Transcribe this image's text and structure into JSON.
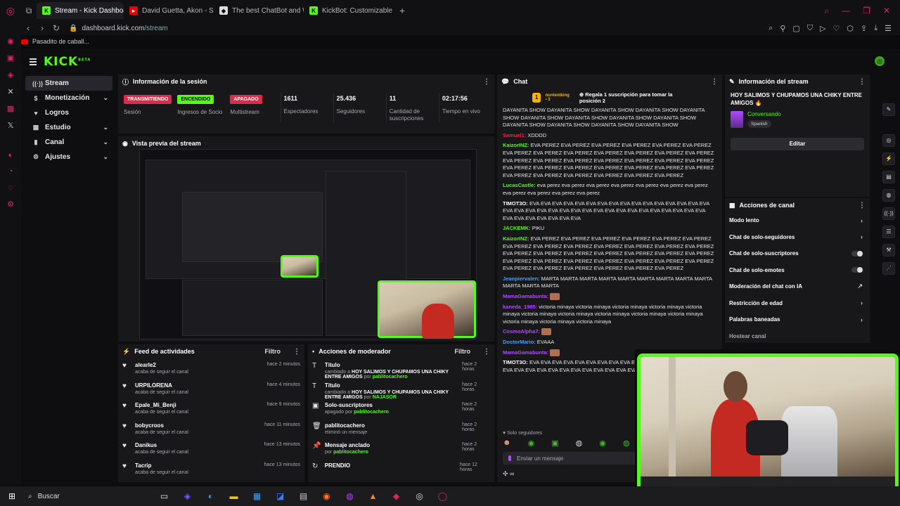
{
  "browser": {
    "tabs": [
      {
        "title": "Stream - Kick Dashboard",
        "active": true
      },
      {
        "title": "David Guetta, Akon - Sex",
        "active": false
      },
      {
        "title": "The best ChatBot and W",
        "active": false
      },
      {
        "title": "KickBot: Customizable Ch",
        "active": false
      }
    ],
    "url_host": "dashboard.kick.com",
    "url_path": "/stream",
    "bookmark": "Pasadito de caball..."
  },
  "app": {
    "logo": "KICK",
    "logo_sup": "BETA",
    "nav": [
      {
        "label": "Stream",
        "icon": "((·))",
        "active": true,
        "chevron": false
      },
      {
        "label": "Monetización",
        "icon": "$",
        "active": false,
        "chevron": true
      },
      {
        "label": "Logros",
        "icon": "♥",
        "active": false,
        "chevron": false
      },
      {
        "label": "Estudio",
        "icon": "▦",
        "active": false,
        "chevron": true
      },
      {
        "label": "Canal",
        "icon": "▮",
        "active": false,
        "chevron": true
      },
      {
        "label": "Ajustes",
        "icon": "⚙",
        "active": false,
        "chevron": true
      }
    ]
  },
  "session": {
    "title": "Información de la sesión",
    "status": [
      {
        "pill": "TRANSMITIENDO",
        "label": "Sesión",
        "color": "red"
      },
      {
        "pill": "ENCENDIDO",
        "label": "Ingresos de Socio",
        "color": "green"
      },
      {
        "pill": "APAGADO",
        "label": "Multistream",
        "color": "red"
      }
    ],
    "stats": [
      {
        "value": "1611",
        "label": "Espectadores"
      },
      {
        "value": "25.436",
        "label": "Seguidores"
      },
      {
        "value": "11",
        "label": "Cantidad de suscripciones"
      },
      {
        "value": "02:17:56",
        "label": "Tiempo en vivo"
      }
    ]
  },
  "preview": {
    "title": "Vista previa del stream"
  },
  "activity": {
    "title": "Feed de actividades",
    "filter": "Filtro",
    "items": [
      {
        "name": "alearle2",
        "sub": "acaba de seguir el canal",
        "time": "hace 2 minutos"
      },
      {
        "name": "URPILORENA",
        "sub": "acaba de seguir el canal",
        "time": "hace 4 minutos"
      },
      {
        "name": "Epale_Mi_Benji",
        "sub": "acaba de seguir el canal",
        "time": "hace 9 minutos"
      },
      {
        "name": "bobycroos",
        "sub": "acaba de seguir el canal",
        "time": "hace 11 minutos"
      },
      {
        "name": "Danikus",
        "sub": "acaba de seguir el canal",
        "time": "hace 13 minutos"
      },
      {
        "name": "Tacrip",
        "sub": "acaba de seguir el canal",
        "time": "hace 13 minutos"
      }
    ]
  },
  "moderator": {
    "title": "Acciones de moderador",
    "filter": "Filtro",
    "items": [
      {
        "icon": "T",
        "name": "Título",
        "pre": "cambiado a",
        "bold": "HOY SALIMOS Y CHUPAMOS UNA CHIKY ENTRE AMIGOS",
        "mid": "por",
        "user": "pablitocachero",
        "time": "hace 2 horas"
      },
      {
        "icon": "T",
        "name": "Título",
        "pre": "cambiado a",
        "bold": "HOY SALIMOS Y CHUPAMOS UNA CHIKY ENTRE AMIGOS",
        "mid": "por",
        "user": "NAJASOR",
        "time": "hace 2 horas"
      },
      {
        "icon": "▣",
        "name": "Solo-suscriptores",
        "pre": "apagado",
        "bold": "",
        "mid": "por",
        "user": "pablitocachero",
        "time": "hace 2 horas"
      },
      {
        "icon": "🗑",
        "name": "pablitocachero",
        "pre": "eliminó un mensaje",
        "bold": "",
        "mid": "",
        "user": "",
        "time": "hace 2 horas"
      },
      {
        "icon": "📌",
        "name": "Mensaje anclado",
        "pre": "",
        "bold": "",
        "mid": "por",
        "user": "pablitocachero",
        "time": "hace 2 horas"
      },
      {
        "icon": "↻",
        "name": "PRENDIO",
        "pre": "",
        "bold": "",
        "mid": "",
        "user": "",
        "time": "hace 12 horas"
      }
    ]
  },
  "chat": {
    "title": "Chat",
    "pinned_user": "nontentking",
    "pinned_count": "3",
    "pinned_text": "Regala 1 suscripción para tomar la posición 2",
    "messages": [
      {
        "user": "",
        "color": "#ffffff",
        "text": "DAYANITA SHOW DAYANITA SHOW DAYANITA SHOW DAYANITA SHOW DAYANITA SHOW DAYANITA SHOW DAYANITA SHOW DAYANITA SHOW DAYANITA SHOW DAYANITA SHOW DAYANITA SHOW DAYANITA SHOW DAYANITA SHOW"
      },
      {
        "user": "Samuel1:",
        "color": "#e02a49",
        "text": "XDDDD"
      },
      {
        "user": "KaizorINZ:",
        "color": "#53fc18",
        "text": "EVA PEREZ EVA PEREZ EVA PEREZ EVA PEREZ EVA PEREZ EVA PEREZ EVA PEREZ EVA PEREZ EVA PEREZ EVA PEREZ EVA PEREZ EVA PEREZ EVA PEREZ EVA PEREZ EVA PEREZ EVA PEREZ EVA PEREZ EVA PEREZ EVA PEREZ EVA PEREZ EVA PEREZ EVA PEREZ EVA PEREZ EVA PEREZ EVA PEREZ EVA PEREZ EVA PEREZ EVA PEREZ EVA PEREZ EVA PEREZ EVA PEREZ EVA PEREZ EVA PEREZ"
      },
      {
        "user": "LucasCastle:",
        "color": "#53fc18",
        "text": "eva perez eva perez eva perez eva perez eva perez eva perez eva perez eva perez eva perez eva perez eva perez"
      },
      {
        "user": "TIMOT3O:",
        "color": "#ffffff",
        "text": "EVA EVA EVA EVA EVA EVA EVA EVA EVA EVA EVA EVA EVA EVA EVA EVA EVA EVA EVA EVA EVA EVA EVA EVA EVA EVA EVA EVA EVA EVA EVA EVA EVA EVA EVA EVA EVA EVA EVA EVA EVA"
      },
      {
        "user": "JACKEMK:",
        "color": "#53fc18",
        "text": "PIKU"
      },
      {
        "user": "KaizorINZ:",
        "color": "#53fc18",
        "text": "EVA PEREZ EVA PEREZ EVA PEREZ EVA PEREZ EVA PEREZ EVA PEREZ EVA PEREZ EVA PEREZ EVA PEREZ EVA PEREZ EVA PEREZ EVA PEREZ EVA PEREZ EVA PEREZ EVA PEREZ EVA PEREZ EVA PEREZ EVA PEREZ EVA PEREZ EVA PEREZ EVA PEREZ EVA PEREZ EVA PEREZ EVA PEREZ EVA PEREZ EVA PEREZ EVA PEREZ EVA PEREZ EVA PEREZ EVA PEREZ EVA PEREZ EVA PEREZ EVA PEREZ"
      },
      {
        "user": "Jeanpiervalen:",
        "color": "#3aa3ff",
        "text": "MARTA MARTA MARTA MARTA MARTA MARTA MARTA MARTA MARTA MARTA MARTA MARTA"
      },
      {
        "user": "MamaGamabunta:",
        "color": "#b04bff",
        "text": ""
      },
      {
        "user": "kaneda_1985:",
        "color": "#b04bff",
        "text": "victoria minaya victoria minaya victoria minaya victoria minaya victoria minaya victoria minaya victoria minaya victoria minaya victoria minaya victoria minaya victoria minaya victoria minaya victoria minaya"
      },
      {
        "user": "CosmoAlpha7:",
        "color": "#b04bff",
        "text": ""
      },
      {
        "user": "DoctorMario:",
        "color": "#3aa3ff",
        "text": "EVAAA"
      },
      {
        "user": "MamaGamabunta:",
        "color": "#b04bff",
        "text": ""
      },
      {
        "user": "TIMOT3O:",
        "color": "#ffffff",
        "text": "EVA EVA EVA EVA EVA EVA EVA EVA EVA EVA EVA EVA EVA EVA EVA EVA EVA EVA EVA EVA EVA EVA EVA EVA EVA EVA EVA EVA EVA EVA EVA"
      }
    ],
    "followers_only": "Solo seguidores",
    "send_placeholder": "Enviar un mensaje"
  },
  "stream_info": {
    "title": "Información del stream",
    "stream_title": "HOY SALIMOS Y CHUPAMOS UNA CHIKY ENTRE AMIGOS 🔥",
    "category": "Conversando",
    "language": "Spanish",
    "edit": "Editar"
  },
  "channel_actions": {
    "title": "Acciones de canal",
    "items": [
      {
        "label": "Modo lento",
        "control": "›"
      },
      {
        "label": "Chat de solo-seguidores",
        "control": "›"
      },
      {
        "label": "Chat de solo-suscriptores",
        "control": "toggle"
      },
      {
        "label": "Chat de solo-emotes",
        "control": "toggle"
      },
      {
        "label": "Moderación del chat con IA",
        "control": "↗"
      },
      {
        "label": "Restricción de edad",
        "control": "›"
      },
      {
        "label": "Palabras baneadas",
        "control": "›"
      },
      {
        "label": "Hostear canal",
        "control": ""
      }
    ]
  },
  "taskbar": {
    "search": "Buscar"
  },
  "colors": {
    "kick_green": "#53fc18",
    "live_red": "#e02a49",
    "panel": "#18181b"
  }
}
